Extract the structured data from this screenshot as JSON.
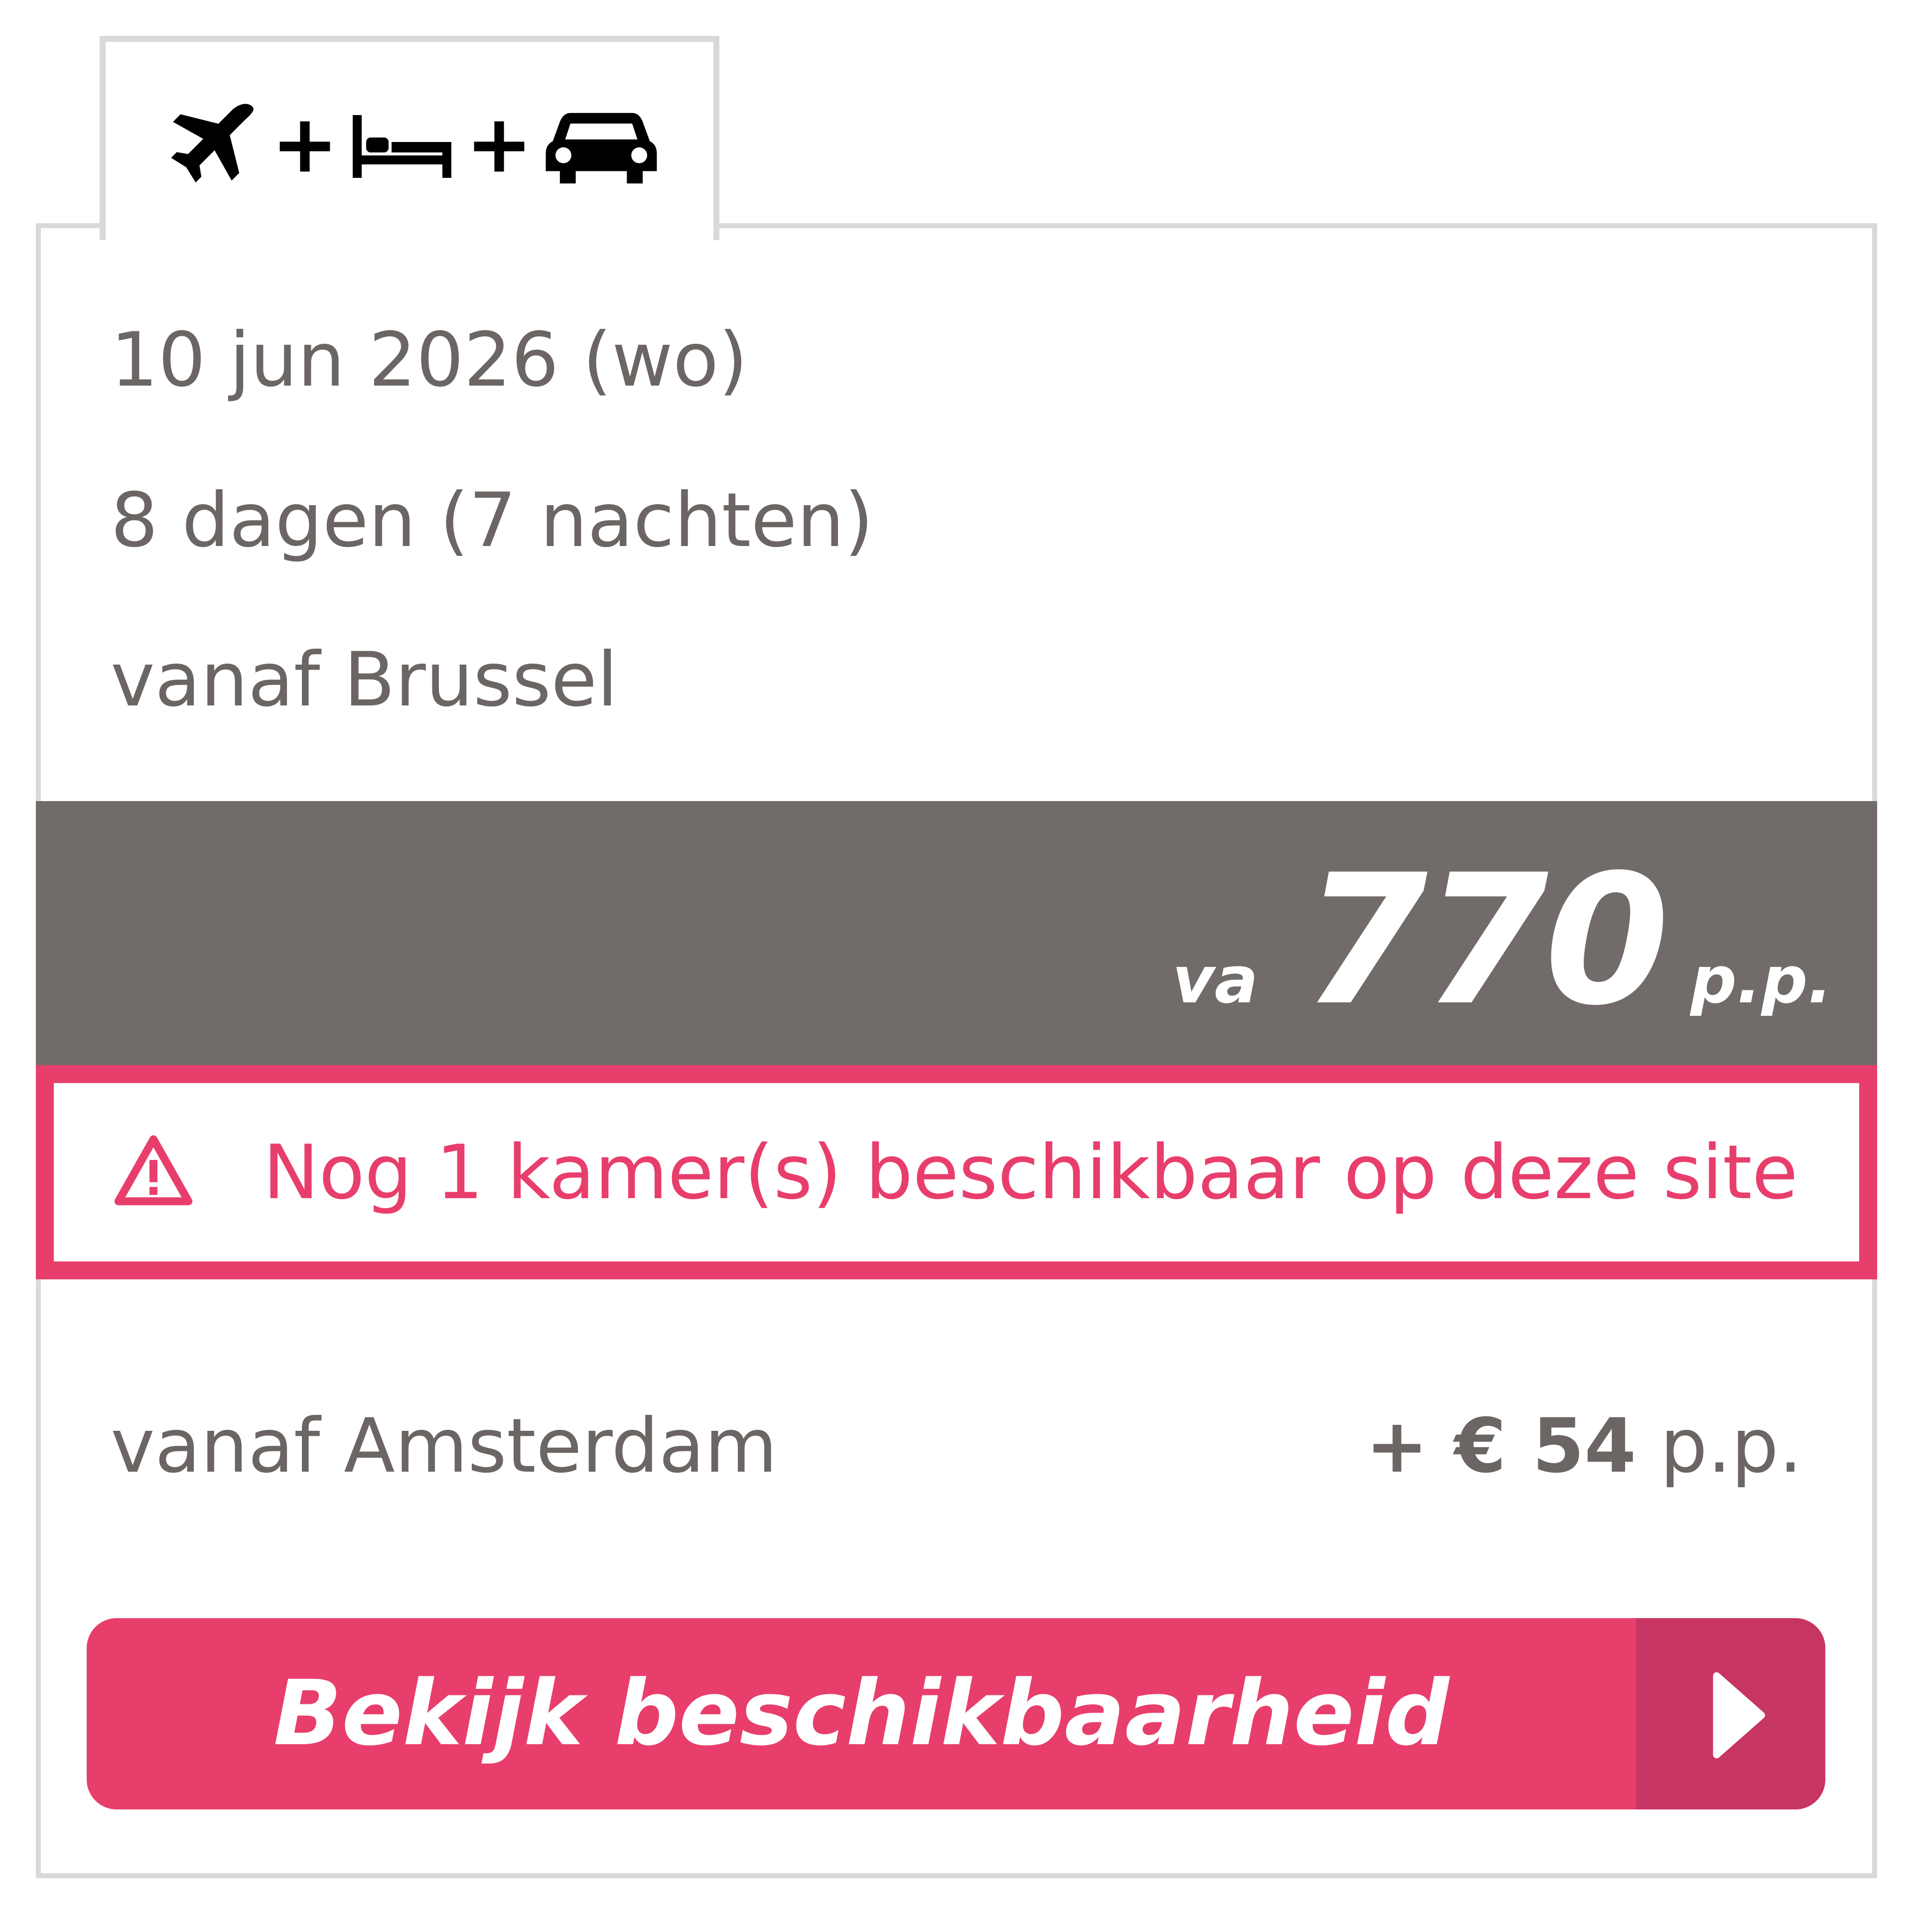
{
  "tab": {
    "icons": [
      "plane-icon",
      "plus-icon",
      "bed-icon",
      "plus-icon",
      "car-icon"
    ]
  },
  "trip": {
    "date": "10 jun 2026 (wo)",
    "duration": "8 dagen (7 nachten)",
    "departure": "vanaf Brussel"
  },
  "price": {
    "prefix": "va",
    "amount": "770",
    "suffix": "p.p."
  },
  "alert": {
    "icon": "warning-icon",
    "text": "Nog 1 kamer(s) beschikbaar op deze site"
  },
  "alternative": {
    "label": "vanaf Amsterdam",
    "surcharge": "+ € 54",
    "suffix": "p.p."
  },
  "cta": {
    "label": "Bekijk beschikbaarheid",
    "icon": "chevron-right-icon"
  },
  "colors": {
    "accent": "#e83e6c",
    "accent_dark": "#c73562",
    "price_bar": "#716c69",
    "text": "#6b6564",
    "border": "#d9d9d9"
  }
}
